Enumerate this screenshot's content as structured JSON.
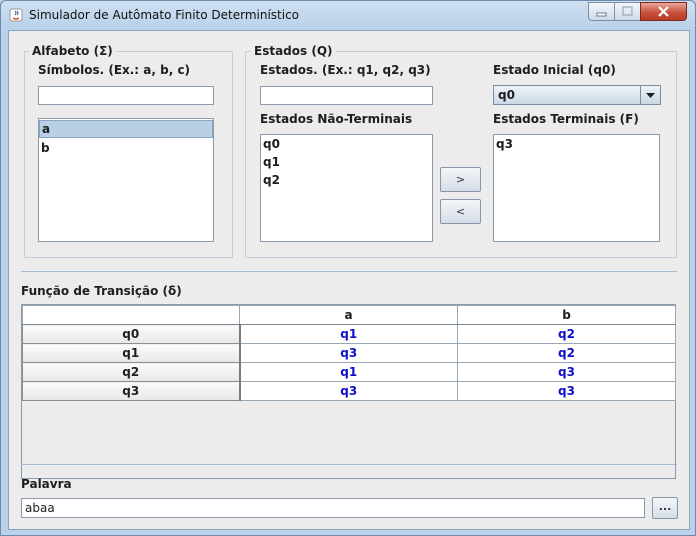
{
  "window": {
    "title": "Simulador de Autômato Finito Determinístico"
  },
  "alphabet": {
    "legend": "Alfabeto (Σ)",
    "symbols_label": "Símbolos. (Ex.: a, b, c)",
    "symbols_value": "",
    "items": [
      "a",
      "b"
    ],
    "selected_index": 0
  },
  "states": {
    "legend": "Estados (Q)",
    "states_label": "Estados. (Ex.: q1, q2, q3)",
    "states_value": "",
    "initial_label": "Estado Inicial (q0)",
    "initial_value": "q0",
    "non_terminal_label": "Estados Não-Terminais",
    "non_terminal_items": [
      "q0",
      "q1",
      "q2"
    ],
    "terminal_label": "Estados Terminais (F)",
    "terminal_items": [
      "q3"
    ],
    "move_right_label": ">",
    "move_left_label": "<"
  },
  "transition": {
    "label": "Função de Transição (δ)",
    "columns": [
      "",
      "a",
      "b"
    ],
    "rows": [
      [
        "q0",
        "q1",
        "q2"
      ],
      [
        "q1",
        "q3",
        "q2"
      ],
      [
        "q2",
        "q1",
        "q3"
      ],
      [
        "q3",
        "q3",
        "q3"
      ]
    ]
  },
  "word": {
    "label": "Palavra",
    "value": "abaa",
    "browse_label": "..."
  },
  "colors": {
    "transition_cell_text": "#1010c8",
    "selection": "#b8cfe5",
    "close_button": "#c9503c"
  }
}
